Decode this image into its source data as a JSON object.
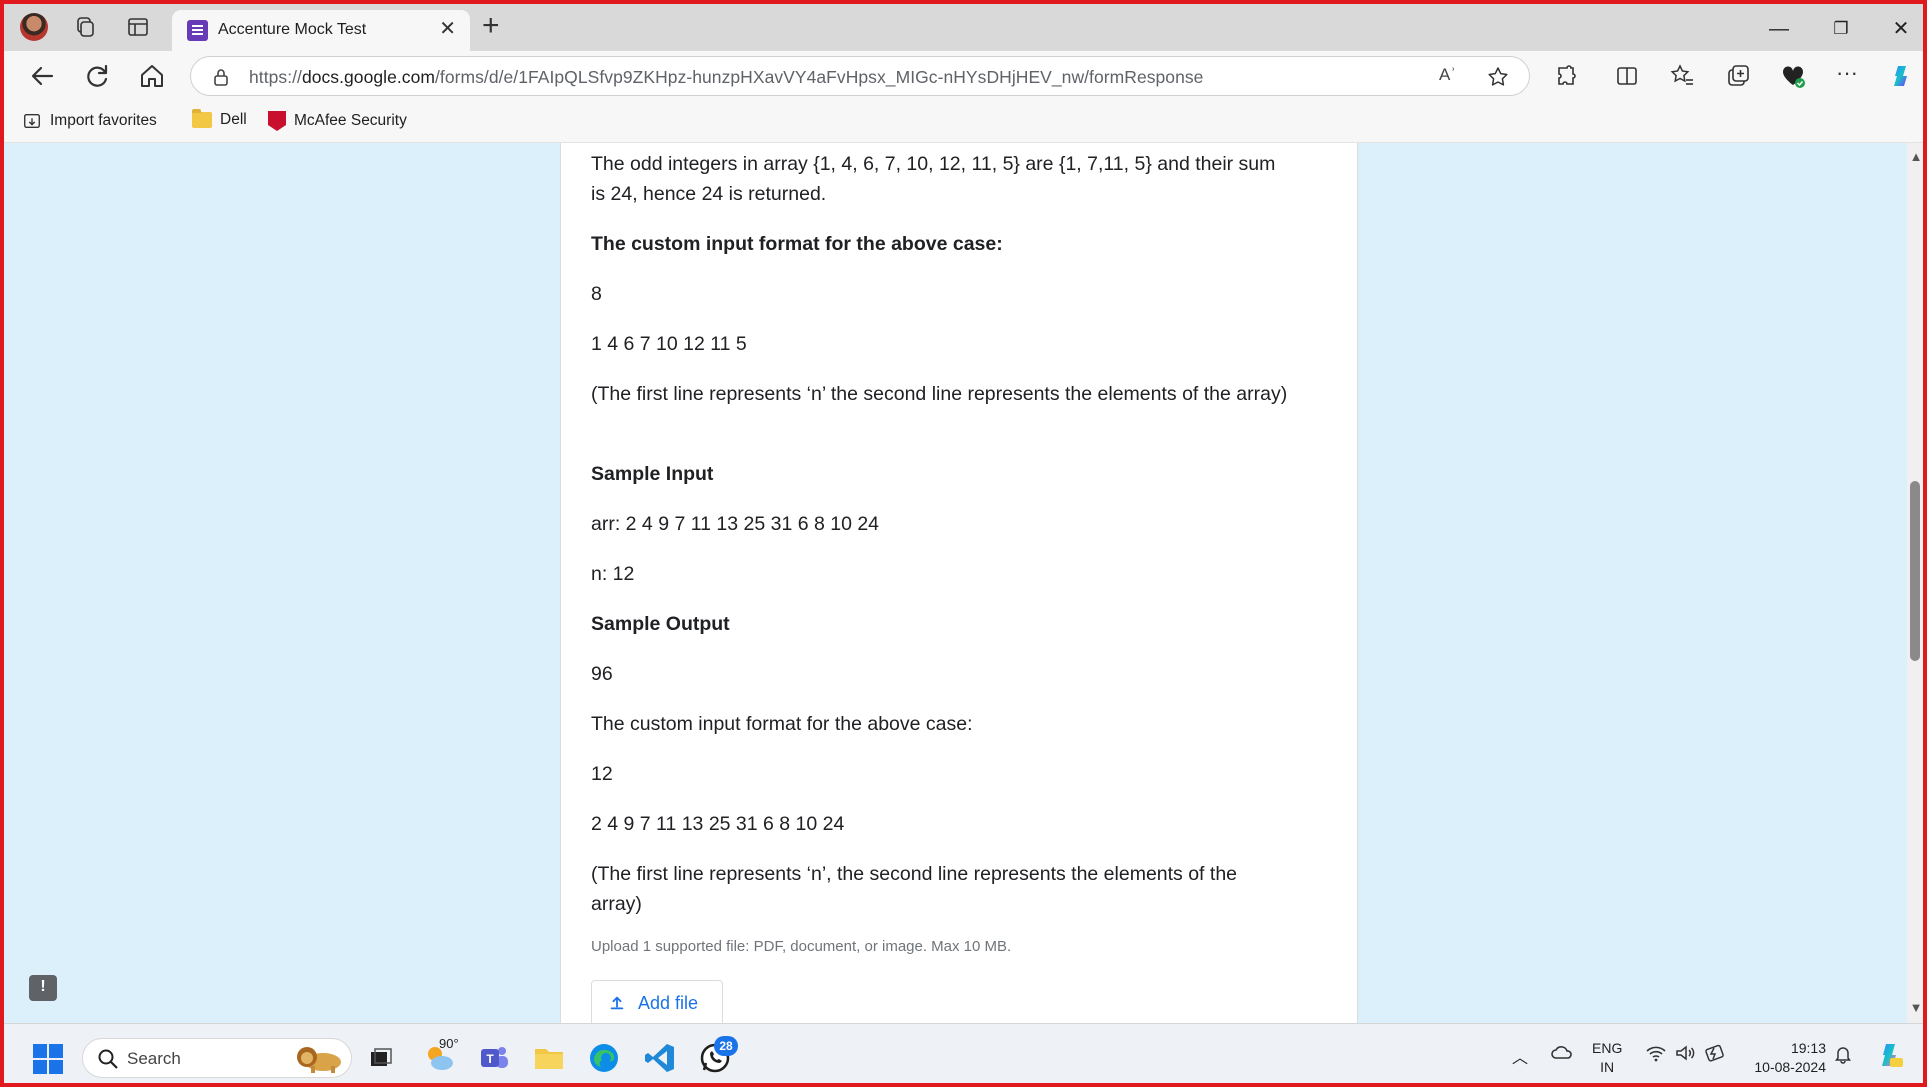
{
  "browser": {
    "tab_title": "Accenture Mock Test",
    "url_prefix": "https://",
    "url_host": "docs.google.com",
    "url_path": "/forms/d/e/1FAIpQLSfvp9ZKHpz-hunzpHXavVY4aFvHpsx_MIGc-nHYsDHjHEV_nw/formResponse",
    "read_aloud_label": "Aʾ"
  },
  "favorites": {
    "import_label": "Import favorites",
    "dell_label": "Dell",
    "mcafee_label": "McAfee Security"
  },
  "form": {
    "paragraphs": [
      {
        "text": "The odd integers in array {1, 4, 6, 7, 10, 12, 11, 5} are {1, 7,11, 5} and their sum is 24, hence 24 is returned.",
        "bold": false
      },
      {
        "text": "The custom input format for the above case:",
        "bold": true
      },
      {
        "text": "8",
        "bold": false
      },
      {
        "text": "1 4 6 7 10 12 11 5",
        "bold": false
      },
      {
        "text": "(The first line represents ‘n’ the second line represents the elements of the array)",
        "bold": false
      },
      {
        "text": "Sample Input",
        "bold": true
      },
      {
        "text": "arr: 2 4 9 7 11 13 25 31 6 8 10 24",
        "bold": false
      },
      {
        "text": "n: 12",
        "bold": false
      },
      {
        "text": "Sample Output",
        "bold": true
      },
      {
        "text": "96",
        "bold": false
      },
      {
        "text": "The custom input format for the above case:",
        "bold": false
      },
      {
        "text": "12",
        "bold": false
      },
      {
        "text": "2 4 9 7 11 13 25 31 6 8 10 24",
        "bold": false
      },
      {
        "text": "(The first line represents ‘n’, the second line represents the elements of the array)",
        "bold": false
      }
    ],
    "upload_hint": "Upload 1 supported file: PDF, document, or image. Max 10 MB.",
    "add_file_label": "Add file",
    "feedback_label": "!"
  },
  "taskbar": {
    "search_placeholder": "Search",
    "weather_temp": "90°",
    "whatsapp_badge": "28",
    "lang_line1": "ENG",
    "lang_line2": "IN",
    "time": "19:13",
    "date": "10-08-2024"
  },
  "colors": {
    "accent": "#1a73e8",
    "form_bg": "#dcf0fb",
    "forms_purple": "#673ab7",
    "frame_red": "#e0191f"
  }
}
